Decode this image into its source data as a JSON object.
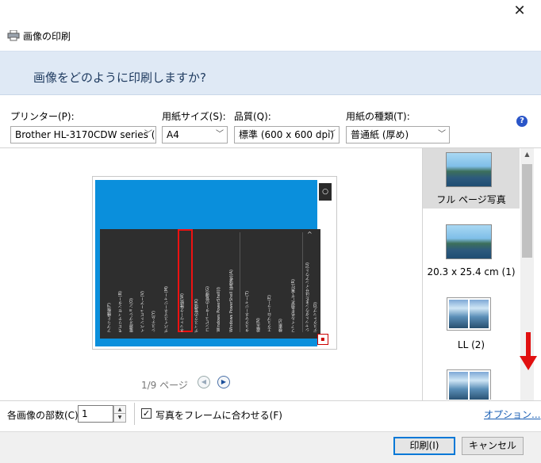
{
  "window": {
    "title": "画像の印刷",
    "close_glyph": "✕"
  },
  "header": {
    "question": "画像をどのように印刷しますか?"
  },
  "settings": {
    "printer": {
      "label": "プリンター(P):",
      "value": "Brother HL-3170CDW series (1"
    },
    "paper_size": {
      "label": "用紙サイズ(S):",
      "value": "A4"
    },
    "quality": {
      "label": "品質(Q):",
      "value": "標準 (600 x 600 dpi)"
    },
    "paper_type": {
      "label": "用紙の種類(T):",
      "value": "普通紙 (厚め)"
    },
    "help_glyph": "?"
  },
  "preview": {
    "menu_items": [
      "アプリと機能(F)",
      "モビリティセンター(B)",
      "電源オプション(O)",
      "イベントビューアー(V)",
      "システム(Y)",
      "デバイスマネージャー(M)",
      "ネットワーク接続(W)",
      "ディスクの管理(K)",
      "コンピューターの管理(G)",
      "Windows PowerShell(I)",
      "Windows PowerShell (管理者)(A)",
      "タスクマネージャー(T)",
      "設定(N)",
      "エクスプローラー(E)",
      "検索(S)",
      "ファイル名を指定して実行(R)",
      "シャットダウンまたはサインアウト(U)",
      "デスクトップ(D)"
    ],
    "page_count": "1/9 ページ",
    "prev_glyph": "◀",
    "next_glyph": "▶"
  },
  "layouts": [
    {
      "label": "フル ページ写真",
      "selected": true
    },
    {
      "label": "20.3 x 25.4 cm (1)",
      "selected": false
    },
    {
      "label": "LL (2)",
      "selected": false
    }
  ],
  "bottom": {
    "copies_label": "各画像の部数(C):",
    "copies_value": "1",
    "fit_label": "写真をフレームに合わせる(F)",
    "fit_checked": true,
    "options_link": "オプション..."
  },
  "buttons": {
    "print": "印刷(I)",
    "cancel": "キャンセル"
  },
  "colors": {
    "annotation": "#e11010",
    "header_band": "#dfe9f5",
    "preview_background": "#0a8fdc"
  }
}
